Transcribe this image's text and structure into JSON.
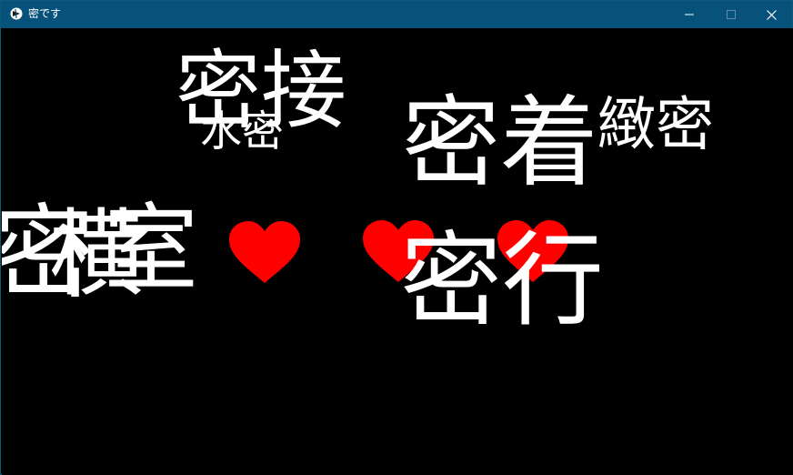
{
  "window": {
    "title": "密です",
    "buttons": {
      "minimize": "minimize-icon",
      "maximize": "maximize-icon",
      "close": "close-icon"
    }
  },
  "canvas": {
    "background": "#000000",
    "text_color": "#ffffff",
    "heart_color": "#ff0000",
    "words": {
      "w1": "密接",
      "w2": "水密",
      "w3": "密着",
      "w4": "緻密",
      "w5": "密",
      "w6": "横",
      "w7": "室",
      "w8": "密行"
    },
    "hearts": [
      "heart-icon",
      "heart-icon",
      "heart-icon"
    ]
  }
}
